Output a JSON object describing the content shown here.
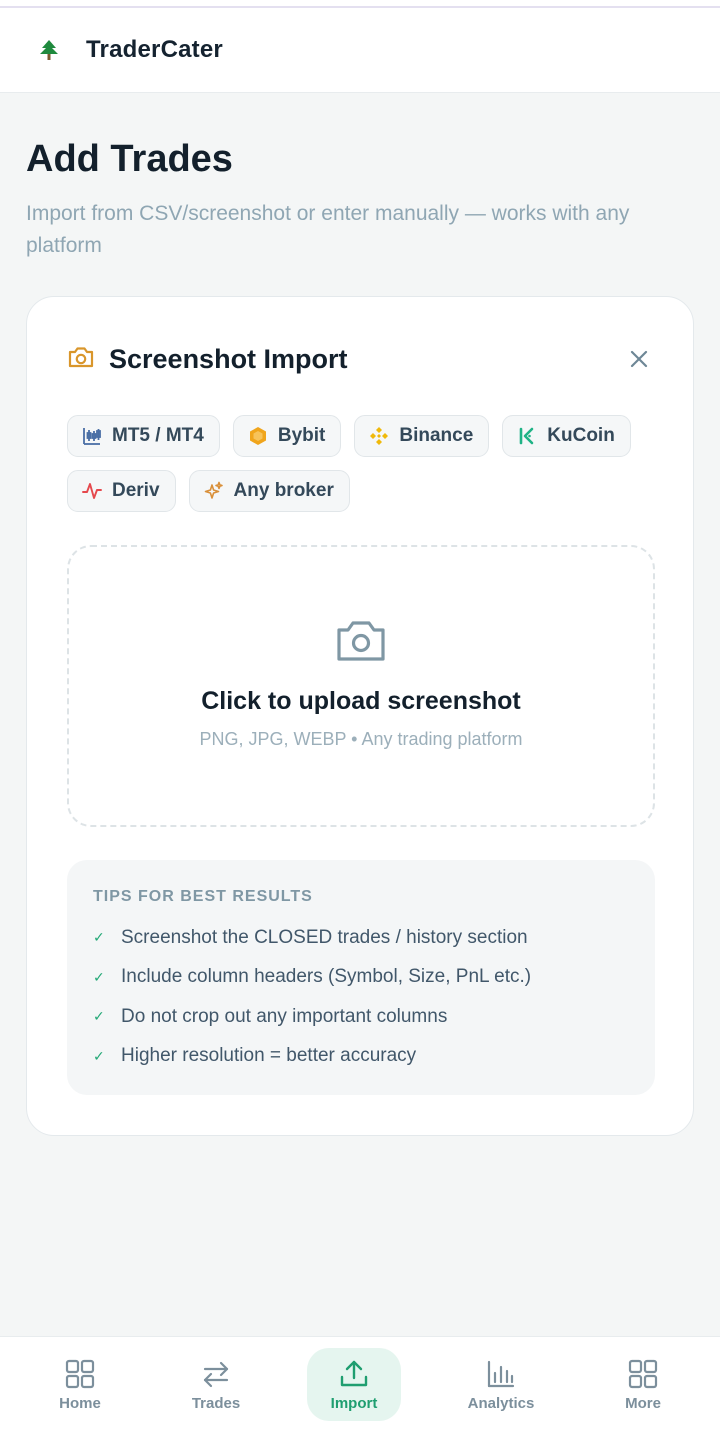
{
  "app": {
    "brand": "TraderCater",
    "logo_icon": "tree-icon",
    "accent": "#1f9e70"
  },
  "page": {
    "title": "Add Trades",
    "subtitle": "Import from CSV/screenshot or enter manually — works with any platform"
  },
  "card": {
    "title": "Screenshot Import",
    "title_icon": "camera-icon",
    "close_icon": "close-icon",
    "brokers": [
      {
        "label": "MT5 / MT4",
        "icon": "candlestick-chart-icon",
        "color": "#4a6fa5"
      },
      {
        "label": "Bybit",
        "icon": "bybit-hexagon-icon",
        "color": "#f0a51c"
      },
      {
        "label": "Binance",
        "icon": "binance-diamond-icon",
        "color": "#f0b90b"
      },
      {
        "label": "KuCoin",
        "icon": "kucoin-k-icon",
        "color": "#1fb386"
      },
      {
        "label": "Deriv",
        "icon": "pulse-icon",
        "color": "#e5484d"
      },
      {
        "label": "Any broker",
        "icon": "sparkles-icon",
        "color": "#d9903a"
      }
    ],
    "upload": {
      "icon": "camera-icon",
      "title": "Click to upload screenshot",
      "subtitle": "PNG, JPG, WEBP • Any trading platform"
    },
    "tips": {
      "title": "TIPS FOR BEST RESULTS",
      "items": [
        "Screenshot the CLOSED trades / history section",
        "Include column headers (Symbol, Size, PnL etc.)",
        "Do not crop out any important columns",
        "Higher resolution = better accuracy"
      ]
    }
  },
  "nav": {
    "items": [
      {
        "label": "Home",
        "icon": "grid-icon",
        "active": false
      },
      {
        "label": "Trades",
        "icon": "swap-arrows-icon",
        "active": false
      },
      {
        "label": "Import",
        "icon": "upload-icon",
        "active": true
      },
      {
        "label": "Analytics",
        "icon": "bar-chart-icon",
        "active": false
      },
      {
        "label": "More",
        "icon": "grid-icon",
        "active": false
      }
    ]
  }
}
